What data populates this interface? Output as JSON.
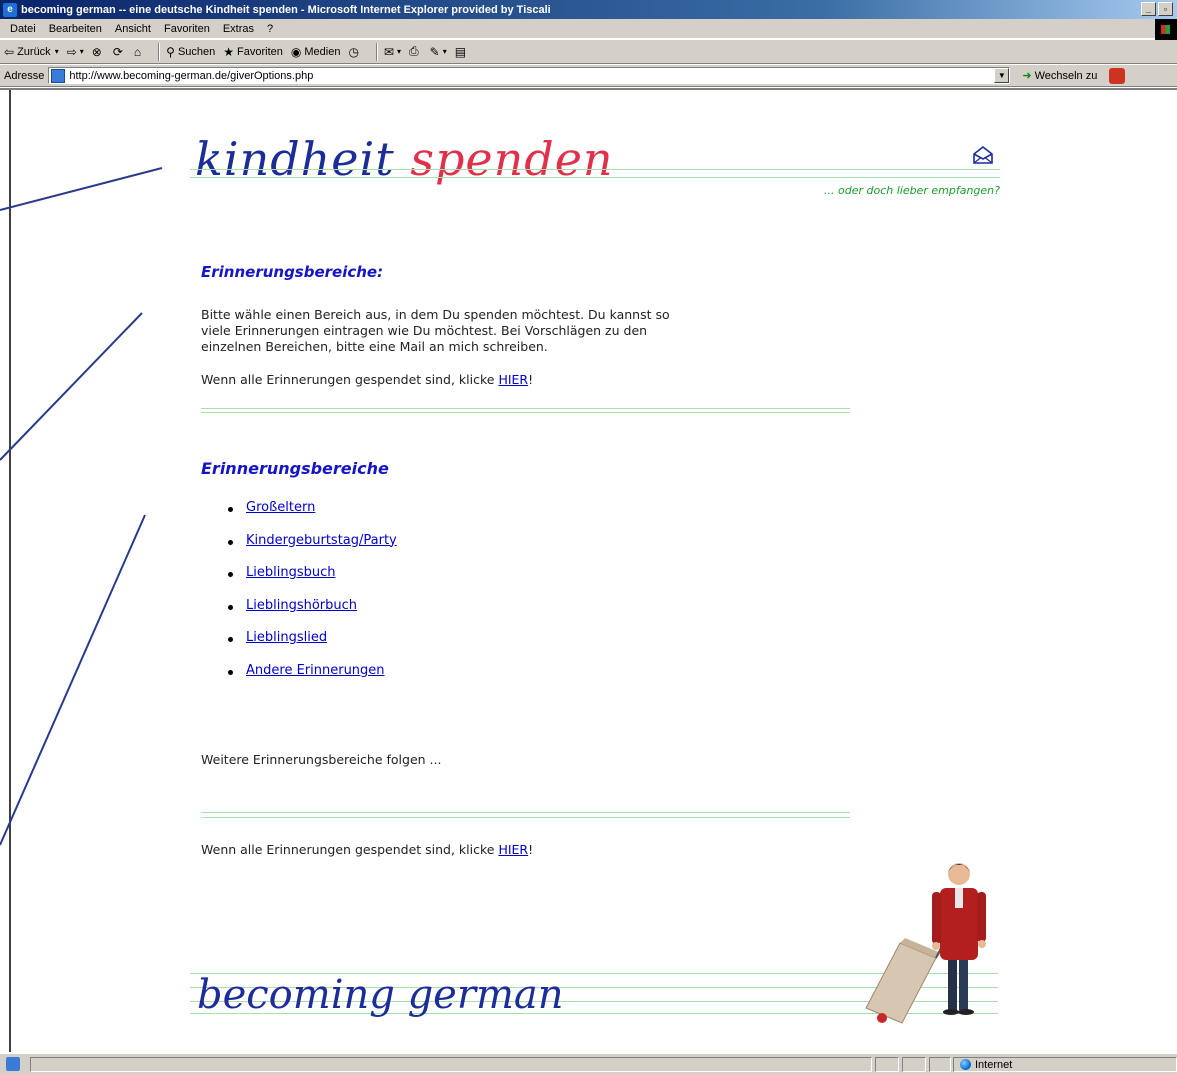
{
  "window": {
    "title": "becoming german -- eine deutsche Kindheit spenden - Microsoft Internet Explorer provided by Tiscali",
    "min_label": "_",
    "max_label": "Д"
  },
  "menu": [
    "Datei",
    "Bearbeiten",
    "Ansicht",
    "Favoriten",
    "Extras",
    "?"
  ],
  "toolbar": {
    "back": "Zurück",
    "search": "Suchen",
    "favorites": "Favoriten",
    "media": "Medien"
  },
  "address": {
    "label": "Adresse",
    "url": "http://www.becoming-german.de/giverOptions.php",
    "go": "Wechseln zu"
  },
  "header": {
    "title_part1": "kindheit",
    "title_part2": "spenden",
    "tagline": "... oder doch lieber empfangen?"
  },
  "section1": {
    "heading": "Erinnerungsbereiche:",
    "intro_line1": "Bitte wähle einen Bereich aus, in dem Du spenden möchtest. Du kannst so",
    "intro_line2": "viele Erinnerungen eintragen wie Du möchtest. Bei Vorschlägen zu den",
    "intro_line3": "einzelnen Bereichen, bitte eine Mail an mich schreiben.",
    "done_prefix": "Wenn alle Erinnerungen gespendet sind, klicke ",
    "done_link": "HIER",
    "done_suffix": "!"
  },
  "section2": {
    "heading": "Erinnerungsbereiche",
    "items": [
      "Großeltern",
      "Kindergeburtstag/Party",
      "Lieblingsbuch",
      "Lieblingshörbuch",
      "Lieblingslied",
      "Andere Erinnerungen"
    ],
    "more": "Weitere Erinnerungsbereiche folgen ...",
    "done_prefix": "Wenn alle Erinnerungen gespendet sind, klicke ",
    "done_link": "HIER",
    "done_suffix": "!"
  },
  "footer": {
    "logo": "becoming german"
  },
  "status": {
    "zone": "Internet"
  },
  "colors": {
    "title_blue": "#1c2d9a",
    "title_red": "#e0304a",
    "heading_blue": "#1515c8",
    "tagline_green": "#1c9e2c",
    "rule_green": "#a8e0a8",
    "annotation_line": "#2a3a8c"
  }
}
